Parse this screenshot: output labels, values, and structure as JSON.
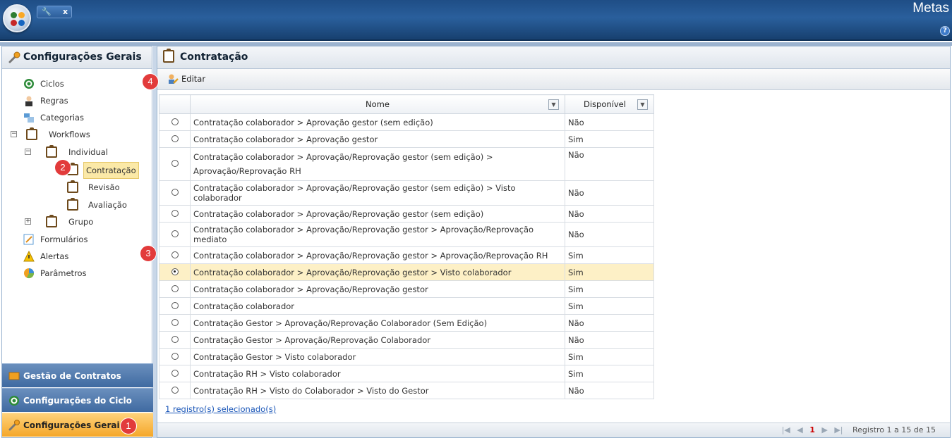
{
  "app": {
    "title": "Metas",
    "help": "?",
    "tab_close": "x"
  },
  "sidebar": {
    "title": "Configurações Gerais",
    "tree": {
      "ciclos": "Ciclos",
      "regras": "Regras",
      "categorias": "Categorias",
      "workflows": "Workflows",
      "individual": "Individual",
      "contratacao": "Contratação",
      "revisao": "Revisão",
      "avaliacao": "Avaliação",
      "grupo": "Grupo",
      "formularios": "Formulários",
      "alertas": "Alertas",
      "parametros": "Parâmetros"
    },
    "accordion": {
      "gestao": "Gestão de Contratos",
      "ciclo": "Configurações do Ciclo",
      "gerais": "Configurações Gerais"
    }
  },
  "main": {
    "title": "Contratação",
    "toolbar": {
      "edit_label": "Editar"
    },
    "grid": {
      "col_nome": "Nome",
      "col_disponivel": "Disponível",
      "rows": [
        {
          "nome": "Contratação colaborador > Aprovação gestor (sem edição)",
          "disp": "Não",
          "selected": false
        },
        {
          "nome": "Contratação colaborador > Aprovação gestor",
          "disp": "Sim",
          "selected": false
        },
        {
          "nome": "Contratação colaborador > Aprovação/Reprovação gestor (sem edição) > Aprovação/Reprovação RH",
          "disp": "Não",
          "selected": false
        },
        {
          "nome": "Contratação colaborador > Aprovação/Reprovação gestor (sem edição) > Visto colaborador",
          "disp": "Não",
          "selected": false
        },
        {
          "nome": "Contratação colaborador > Aprovação/Reprovação gestor (sem edição)",
          "disp": "Não",
          "selected": false
        },
        {
          "nome": "Contratação colaborador > Aprovação/Reprovação gestor > Aprovação/Reprovação mediato",
          "disp": "Não",
          "selected": false
        },
        {
          "nome": "Contratação colaborador > Aprovação/Reprovação gestor > Aprovação/Reprovação RH",
          "disp": "Sim",
          "selected": false
        },
        {
          "nome": "Contratação colaborador > Aprovação/Reprovação gestor > Visto colaborador",
          "disp": "Sim",
          "selected": true
        },
        {
          "nome": "Contratação colaborador > Aprovação/Reprovação gestor",
          "disp": "Sim",
          "selected": false
        },
        {
          "nome": "Contratação colaborador",
          "disp": "Sim",
          "selected": false
        },
        {
          "nome": "Contratação Gestor > Aprovação/Reprovação Colaborador (Sem Edição)",
          "disp": "Não",
          "selected": false
        },
        {
          "nome": "Contratação Gestor > Aprovação/Reprovação Colaborador",
          "disp": "Não",
          "selected": false
        },
        {
          "nome": "Contratação Gestor > Visto colaborador",
          "disp": "Sim",
          "selected": false
        },
        {
          "nome": "Contratação RH > Visto colaborador",
          "disp": "Sim",
          "selected": false
        },
        {
          "nome": "Contratação RH > Visto do Colaborador > Visto do Gestor",
          "disp": "Não",
          "selected": false
        }
      ]
    },
    "selection_text": "1 registro(s) selecionado(s)",
    "pager": {
      "current_page": "1",
      "info": "Registro 1 a 15 de 15"
    }
  },
  "badges": {
    "b1": "1",
    "b2": "2",
    "b3": "3",
    "b4": "4"
  },
  "colors": {
    "accent": "#f4a72a",
    "brand": "#2a5f9c",
    "badge": "#e23b3b"
  }
}
